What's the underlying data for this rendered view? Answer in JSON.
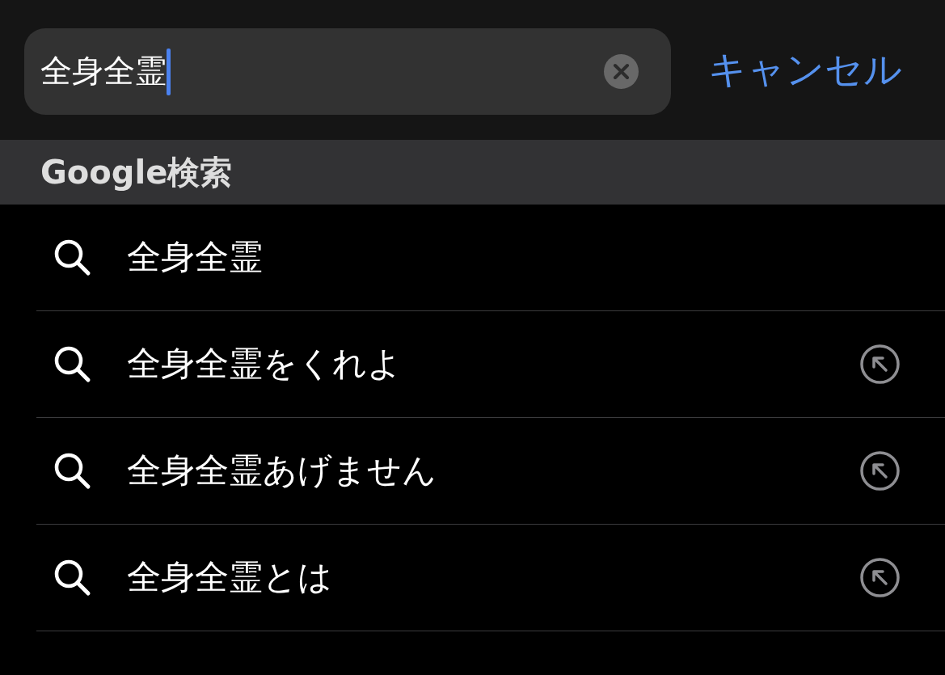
{
  "search_bar": {
    "value": "全身全霊",
    "focused": true,
    "cancel": "キャンセル"
  },
  "section": {
    "title": "Google検索"
  },
  "suggestions": [
    {
      "text": "全身全霊",
      "kind": "query"
    },
    {
      "text": "全身全霊をくれよ",
      "kind": "suggestion"
    },
    {
      "text": "全身全霊あげません",
      "kind": "suggestion"
    },
    {
      "text": "全身全霊とは",
      "kind": "suggestion"
    }
  ]
}
